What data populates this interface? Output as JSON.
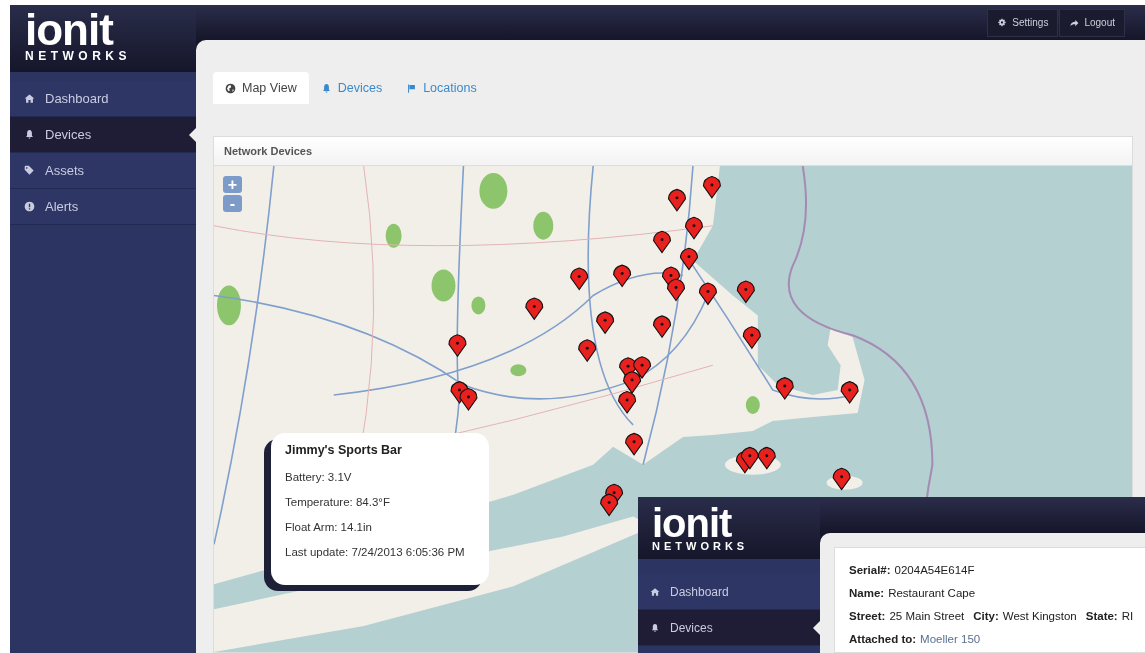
{
  "logo": {
    "name": "ionit",
    "tagline": "NETWORKS"
  },
  "top_buttons": [
    {
      "label": "Settings",
      "kind": "settings"
    },
    {
      "label": "Logout",
      "kind": "logout"
    }
  ],
  "sidebar": {
    "items": [
      {
        "label": "Dashboard",
        "kind": "home",
        "selected": false
      },
      {
        "label": "Devices",
        "kind": "bell",
        "selected": true
      },
      {
        "label": "Assets",
        "kind": "tags",
        "selected": false
      },
      {
        "label": "Alerts",
        "kind": "alert",
        "selected": false
      }
    ]
  },
  "tabs": [
    {
      "label": "Map View",
      "kind": "globe",
      "selected": true
    },
    {
      "label": "Devices",
      "kind": "bell",
      "selected": false
    },
    {
      "label": "Locations",
      "kind": "flag",
      "selected": false
    }
  ],
  "panel": {
    "title": "Network Devices",
    "zoom_in": "+",
    "zoom_out": "-",
    "popup": {
      "title": "Jimmy's Sports Bar",
      "lines": [
        "Battery: 3.1V",
        "Temperature: 84.3°F",
        "Float Arm: 14.1in",
        "Last update: 7/24/2013 6:05:36 PM"
      ]
    }
  },
  "inset": {
    "logo": {
      "name": "ionit",
      "tagline": "NETWORKS"
    },
    "sidebar": {
      "items": [
        {
          "label": "Dashboard",
          "kind": "home",
          "selected": false
        },
        {
          "label": "Devices",
          "kind": "bell",
          "selected": true
        }
      ]
    },
    "rows": [
      [
        {
          "label": "Serial#:",
          "value": "0204A54E614F"
        }
      ],
      [
        {
          "label": "Name:",
          "value": "Restaurant Cape"
        }
      ],
      [
        {
          "label": "Street:",
          "value": "25 Main Street"
        },
        {
          "label": "City:",
          "value": "West Kingston"
        },
        {
          "label": "State:",
          "value": "RI"
        }
      ],
      [
        {
          "label": "Attached to:",
          "value": "Moeller 150"
        }
      ]
    ]
  }
}
